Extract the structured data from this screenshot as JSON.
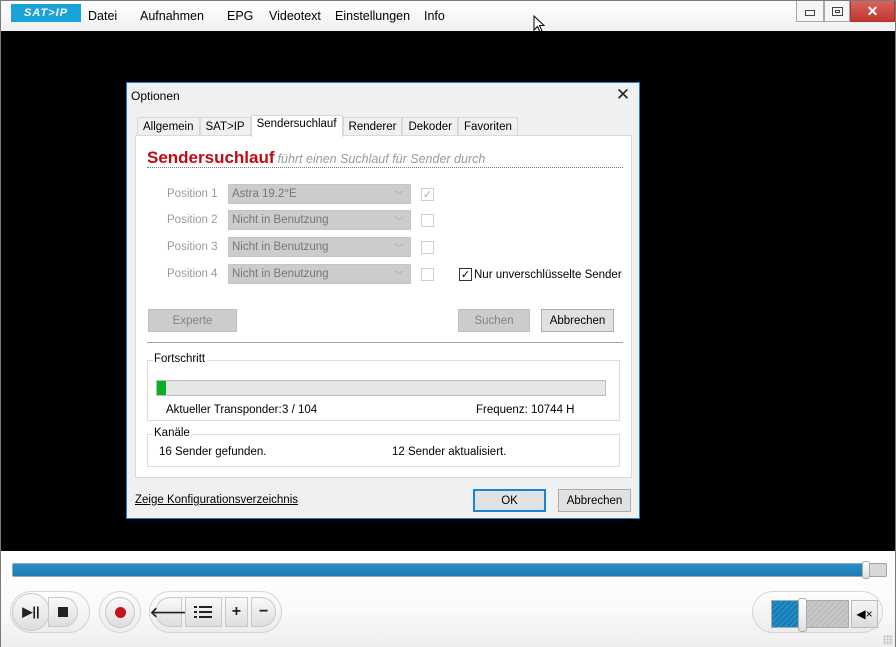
{
  "app": {
    "logo": "SAT>IP",
    "menu": [
      "Datei",
      "Aufnahmen",
      "EPG",
      "Videotext",
      "Einstellungen",
      "Info"
    ],
    "window_controls": {
      "minimize": "minimize-icon",
      "restore": "restore-icon",
      "close": "✕"
    }
  },
  "player": {
    "seek_progress_percent": 97.7,
    "volume_percent": 40,
    "mute_glyph": "🔇"
  },
  "dialog": {
    "title": "Optionen",
    "close_glyph": "✕",
    "tabs": [
      {
        "label": "Allgemein",
        "active": false
      },
      {
        "label": "SAT>IP",
        "active": false
      },
      {
        "label": "Sendersuchlauf",
        "active": true
      },
      {
        "label": "Renderer",
        "active": false
      },
      {
        "label": "Dekoder",
        "active": false
      },
      {
        "label": "Favoriten",
        "active": false
      }
    ],
    "heading": {
      "title": "Sendersuchlauf",
      "subtitle": "führt einen Suchlauf für Sender durch"
    },
    "positions": [
      {
        "label": "Position 1",
        "value": "Astra 19.2°E",
        "checked": true
      },
      {
        "label": "Position 2",
        "value": "Nicht in Benutzung",
        "checked": false
      },
      {
        "label": "Position 3",
        "value": "Nicht in Benutzung",
        "checked": false
      },
      {
        "label": "Position 4",
        "value": "Nicht in Benutzung",
        "checked": false
      }
    ],
    "unencrypted_only": {
      "label": "Nur unverschlüsselte Sender",
      "checked": true
    },
    "buttons": {
      "expert": "Experte",
      "search": "Suchen",
      "cancel_scan": "Abbrechen",
      "ok": "OK",
      "cancel": "Abbrechen"
    },
    "progress": {
      "group_label": "Fortschritt",
      "transponder_label": "Aktueller Transponder:",
      "transponder_value": "3 / 104",
      "frequency_label": "Frequenz:",
      "frequency_value": "10744 H",
      "fill_fraction": 0.02
    },
    "channels": {
      "group_label": "Kanäle",
      "found": "16 Sender gefunden.",
      "updated": "12 Sender aktualisiert."
    },
    "config_link": "Zeige Konfigurationsverzeichnis"
  }
}
